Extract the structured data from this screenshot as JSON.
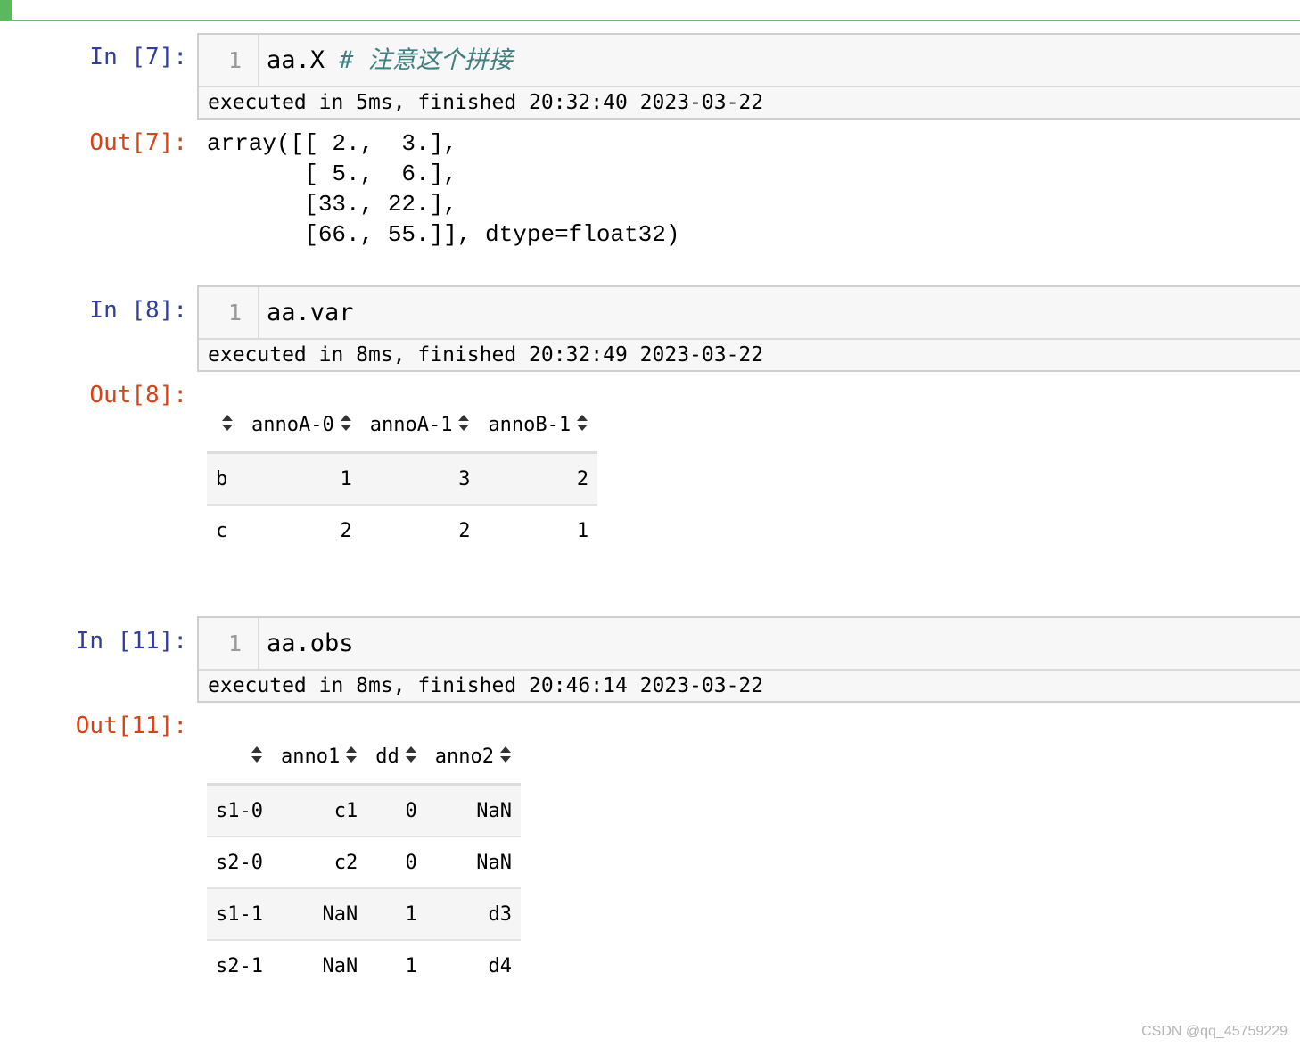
{
  "cells": [
    {
      "in_prompt": "In [7]:",
      "line_no": "1",
      "code": "aa.X ",
      "comment": "# 注意这个拼接",
      "exec_info": "executed in 5ms, finished 20:32:40 2023-03-22",
      "out_prompt": "Out[7]:",
      "output_text": "array([[ 2.,  3.],\n       [ 5.,  6.],\n       [33., 22.],\n       [66., 55.]], dtype=float32)"
    },
    {
      "in_prompt": "In [8]:",
      "line_no": "1",
      "code": "aa.var",
      "exec_info": "executed in 8ms, finished 20:32:49 2023-03-22",
      "out_prompt": "Out[8]:",
      "table": {
        "columns": [
          "annoA-0",
          "annoA-1",
          "annoB-1"
        ],
        "rows": [
          {
            "index": "b",
            "values": [
              "1",
              "3",
              "2"
            ]
          },
          {
            "index": "c",
            "values": [
              "2",
              "2",
              "1"
            ]
          }
        ]
      }
    },
    {
      "in_prompt": "In [11]:",
      "line_no": "1",
      "code": "aa.obs",
      "exec_info": "executed in 8ms, finished 20:46:14 2023-03-22",
      "out_prompt": "Out[11]:",
      "table": {
        "columns": [
          "anno1",
          "dd",
          "anno2"
        ],
        "rows": [
          {
            "index": "s1-0",
            "values": [
              "c1",
              "0",
              "NaN"
            ]
          },
          {
            "index": "s2-0",
            "values": [
              "c2",
              "0",
              "NaN"
            ]
          },
          {
            "index": "s1-1",
            "values": [
              "NaN",
              "1",
              "d3"
            ]
          },
          {
            "index": "s2-1",
            "values": [
              "NaN",
              "1",
              "d4"
            ]
          }
        ]
      }
    }
  ],
  "watermark": "CSDN @qq_45759229",
  "colors": {
    "in_prompt": "#303f9f",
    "out_prompt": "#d84315",
    "comment": "#408080",
    "cell_border_active": "#5cb85c"
  },
  "icons": {
    "sort": "sort-icon"
  }
}
